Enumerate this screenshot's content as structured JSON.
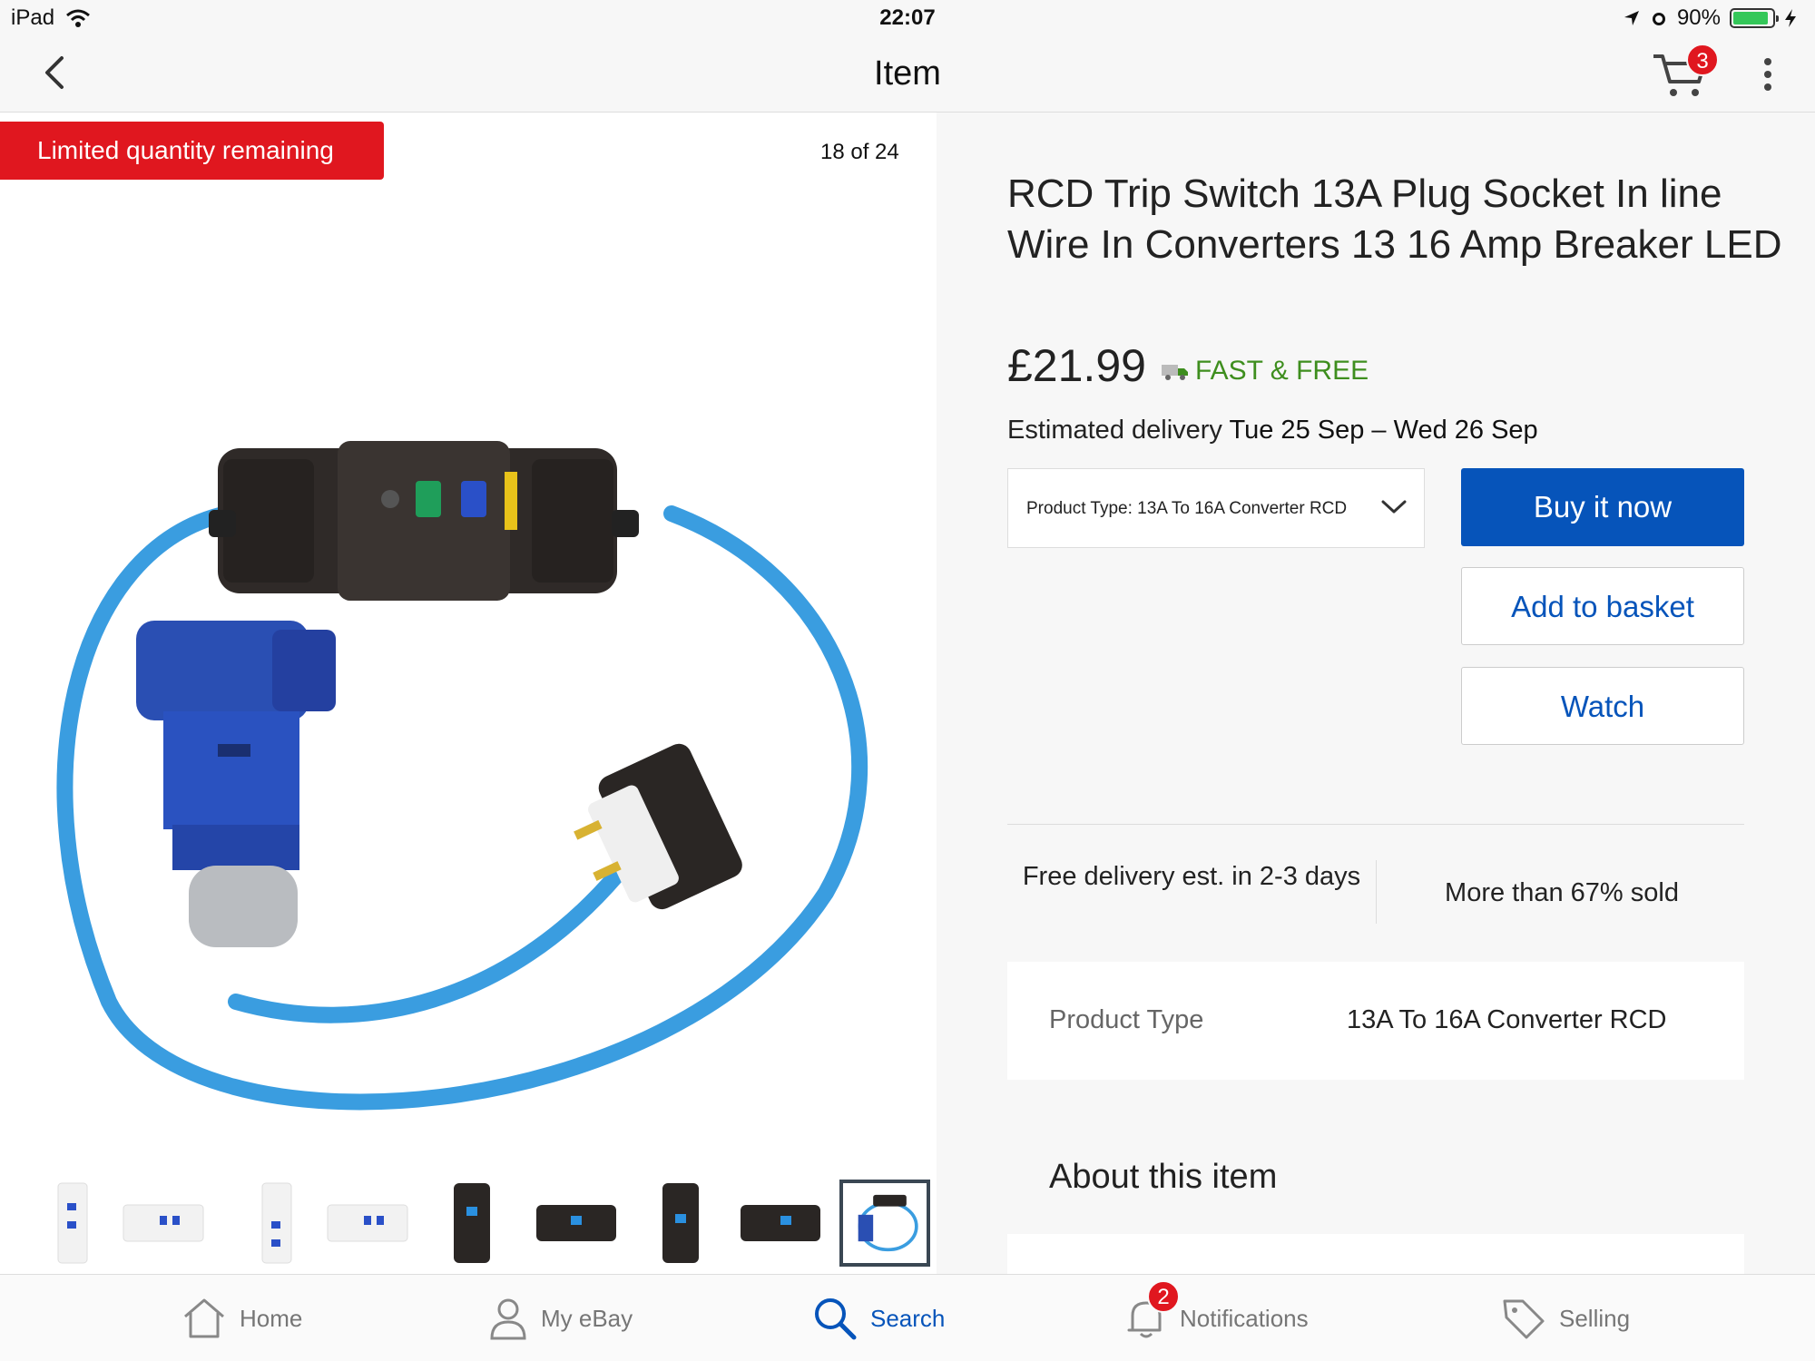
{
  "status_bar": {
    "device": "iPad",
    "time": "22:07",
    "battery": "90%"
  },
  "nav": {
    "title": "Item",
    "cart_count": "3"
  },
  "gallery": {
    "banner": "Limited quantity remaining",
    "counter": "18 of 24",
    "thumbnail_count": 9,
    "active_thumbnail": 9
  },
  "product": {
    "title": "RCD Trip Switch 13A Plug Socket In line Wire In Converters 13 16 Amp Breaker LED",
    "price": "£21.99",
    "shipping_badge": "FAST & FREE",
    "estimated_label": "Estimated delivery",
    "estimated_dates": "Tue 25 Sep – Wed 26 Sep",
    "variant_select": "Product Type: 13A To 16A Converter RCD",
    "buy_now": "Buy it now",
    "add_to_basket": "Add to basket",
    "watch": "Watch",
    "stat_delivery": "Free delivery est. in 2-3 days",
    "stat_sold": "More than 67% sold",
    "spec_label": "Product Type",
    "spec_value": "13A To 16A Converter RCD",
    "about_heading": "About this item"
  },
  "tabbar": {
    "home": "Home",
    "myebay": "My eBay",
    "search": "Search",
    "notifications": "Notifications",
    "notifications_count": "2",
    "selling": "Selling"
  },
  "colors": {
    "accent_blue": "#0654ba",
    "badge_red": "#e0171f",
    "free_green": "#3e8e1e",
    "cable_blue": "#3a9de0"
  }
}
